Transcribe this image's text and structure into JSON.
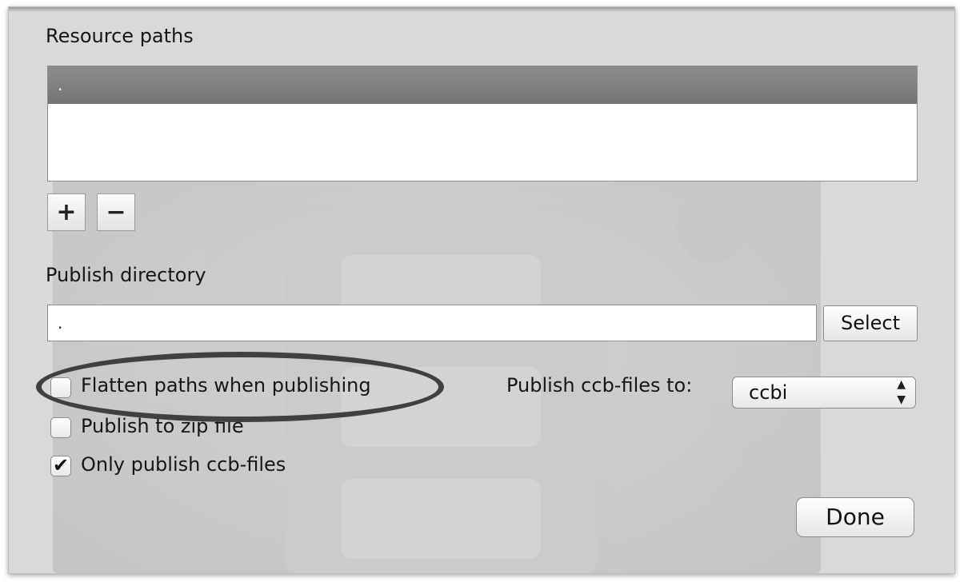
{
  "resource_paths": {
    "heading": "Resource paths",
    "items": [
      "."
    ],
    "add_label": "+",
    "remove_label": "−"
  },
  "publish_directory": {
    "heading": "Publish directory",
    "value": ".",
    "select_label": "Select"
  },
  "options": {
    "flatten_paths": {
      "label": "Flatten paths when publishing",
      "checked": false
    },
    "publish_zip": {
      "label": "Publish to zip file",
      "checked": false
    },
    "only_ccb": {
      "label": "Only publish ccb-files",
      "checked": true,
      "mark": "✔"
    }
  },
  "publish_ccb": {
    "label": "Publish ccb-files to:",
    "selected": "ccbi"
  },
  "done_label": "Done",
  "colors": {
    "selection_row": "#808080",
    "annotation_ring": "#404040",
    "sheet_background": "#d9d9d9"
  }
}
